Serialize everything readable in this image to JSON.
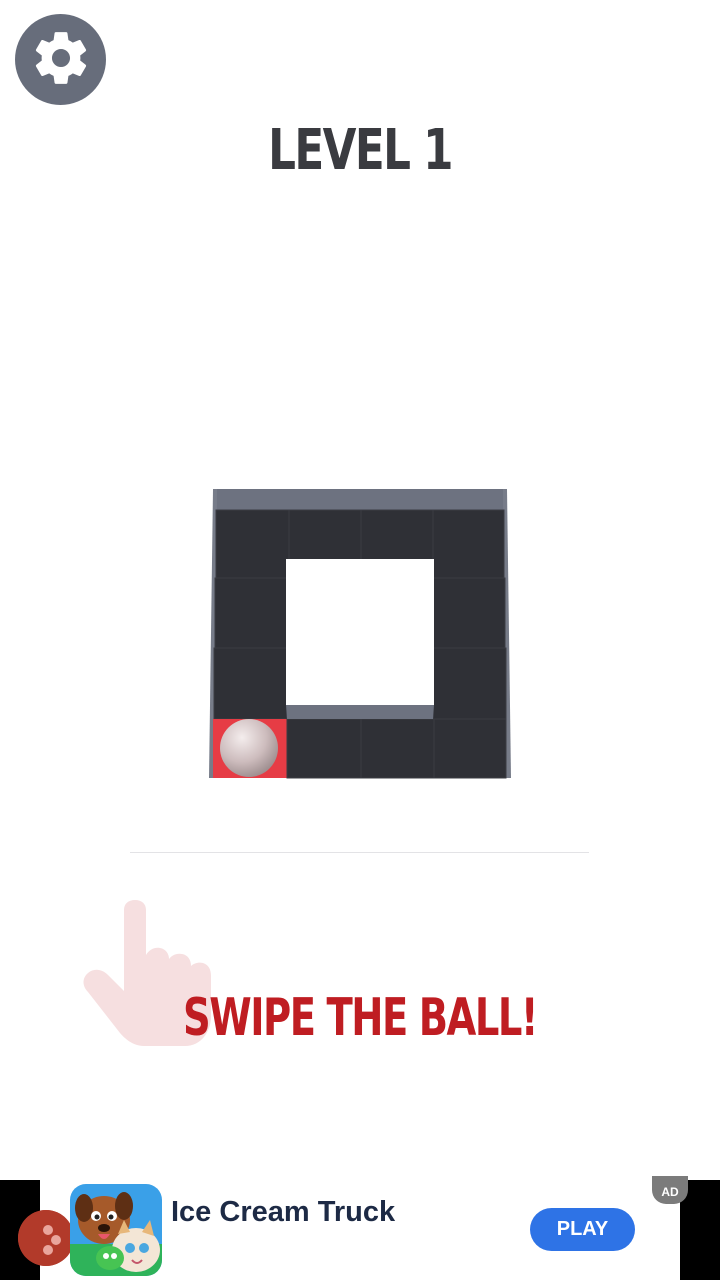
{
  "header": {
    "settings_icon": "gear-icon",
    "level_title": "LEVEL 1"
  },
  "game": {
    "grid": {
      "columns": 4,
      "rows": 4,
      "ball_cell": [
        0,
        3
      ],
      "painted_cells": [
        [
          0,
          3
        ]
      ],
      "hole_cells": [
        [
          1,
          1
        ],
        [
          2,
          1
        ]
      ]
    },
    "colors": {
      "tile": "#2f3036",
      "wall": "#6d7280",
      "painted": "#e63c45",
      "ball": "#d8c7c8"
    }
  },
  "tutorial": {
    "hand_icon": "pointing-hand-icon",
    "instruction": "SWIPE THE BALL!"
  },
  "ad": {
    "app_name": "Ice Cream Truck",
    "cta_label": "PLAY",
    "badge": "AD",
    "accent": "#2e73e6"
  }
}
